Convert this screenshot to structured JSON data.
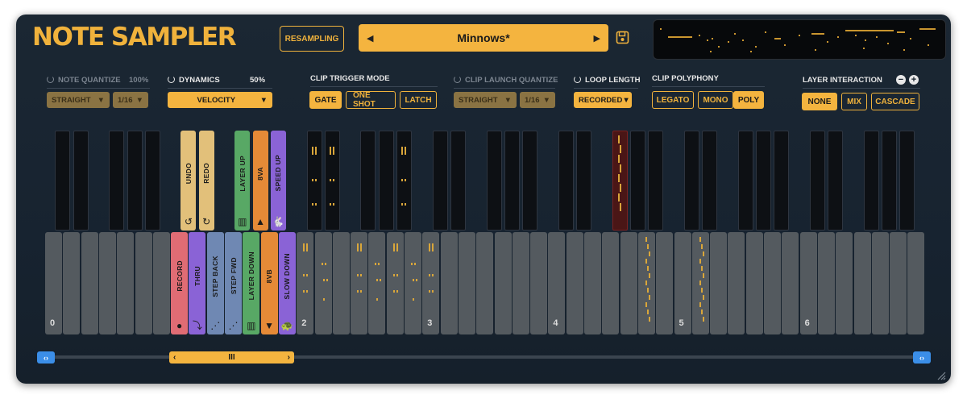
{
  "app": {
    "title": "NOTE SAMPLER"
  },
  "toolbar": {
    "resampling_label": "RESAMPLING"
  },
  "preset": {
    "name": "Minnows*",
    "prev_icon": "triangle-left-icon",
    "next_icon": "triangle-right-icon"
  },
  "controls": {
    "note_quantize": {
      "label": "NOTE QUANTIZE",
      "percent": "100%",
      "mode": "STRAIGHT",
      "division": "1/16"
    },
    "dynamics": {
      "label": "DYNAMICS",
      "percent": "50%",
      "value": "VELOCITY"
    },
    "clip_trigger_mode": {
      "label": "CLIP TRIGGER MODE",
      "options": [
        "GATE",
        "ONE SHOT",
        "LATCH"
      ],
      "selected": "GATE"
    },
    "clip_launch_quantize": {
      "label": "CLIP LAUNCH QUANTIZE",
      "mode": "STRAIGHT",
      "division": "1/16"
    },
    "loop_length": {
      "label": "LOOP LENGTH",
      "value": "RECORDED"
    },
    "clip_polyphony": {
      "label": "CLIP POLYPHONY",
      "options": [
        "LEGATO",
        "MONO",
        "POLY"
      ],
      "selected": "POLY"
    },
    "layer_interaction": {
      "label": "LAYER INTERACTION",
      "options": [
        "NONE",
        "MIX",
        "CASCADE"
      ],
      "selected": "NONE"
    }
  },
  "action_keys": {
    "black": [
      {
        "label": "UNDO",
        "icon": "undo-icon",
        "glyph": "↺",
        "color": "#e2c07a"
      },
      {
        "label": "REDO",
        "icon": "redo-icon",
        "glyph": "↻",
        "color": "#e2c07a"
      },
      {
        "label": "LAYER UP",
        "icon": "piano-keys-icon",
        "glyph": "▥",
        "color": "#58a865"
      },
      {
        "label": "8VA",
        "icon": "triangle-up-icon",
        "glyph": "▲",
        "color": "#e58a37"
      },
      {
        "label": "SPEED UP",
        "icon": "rabbit-icon",
        "glyph": "🐇",
        "color": "#8a63d6"
      }
    ],
    "white": [
      {
        "label": "RECORD",
        "icon": "record-dot-icon",
        "glyph": "●",
        "color": "#e06c74"
      },
      {
        "label": "THRU",
        "icon": "bypass-icon",
        "glyph": "⤵",
        "color": "#8a63d6"
      },
      {
        "label": "STEP BACK",
        "icon": "footsteps-back-icon",
        "glyph": "⋰",
        "color": "#6f88b3"
      },
      {
        "label": "STEP FWD",
        "icon": "footsteps-forward-icon",
        "glyph": "⋰",
        "color": "#6f88b3"
      },
      {
        "label": "LAYER DOWN",
        "icon": "piano-keys-icon",
        "glyph": "▥",
        "color": "#58a865"
      },
      {
        "label": "8VB",
        "icon": "triangle-down-icon",
        "glyph": "▼",
        "color": "#e58a37"
      },
      {
        "label": "SLOW DOWN",
        "icon": "turtle-icon",
        "glyph": "🐢",
        "color": "#8a63d6"
      }
    ]
  },
  "keyboard": {
    "octave_labels": [
      "0",
      "2",
      "3",
      "4",
      "5",
      "6"
    ]
  },
  "scrollbar": {
    "left_icon": "arrows-left-right-icon",
    "right_icon": "arrows-left-right-icon",
    "thumb_grip": "III"
  },
  "layer_buttons": {
    "minus": "−",
    "plus": "+"
  },
  "colors": {
    "accent": "#f4b43f",
    "background": "#172330",
    "key_white": "#545a5f",
    "key_black": "#0d1014",
    "scroll_blue": "#3b8ee8"
  }
}
